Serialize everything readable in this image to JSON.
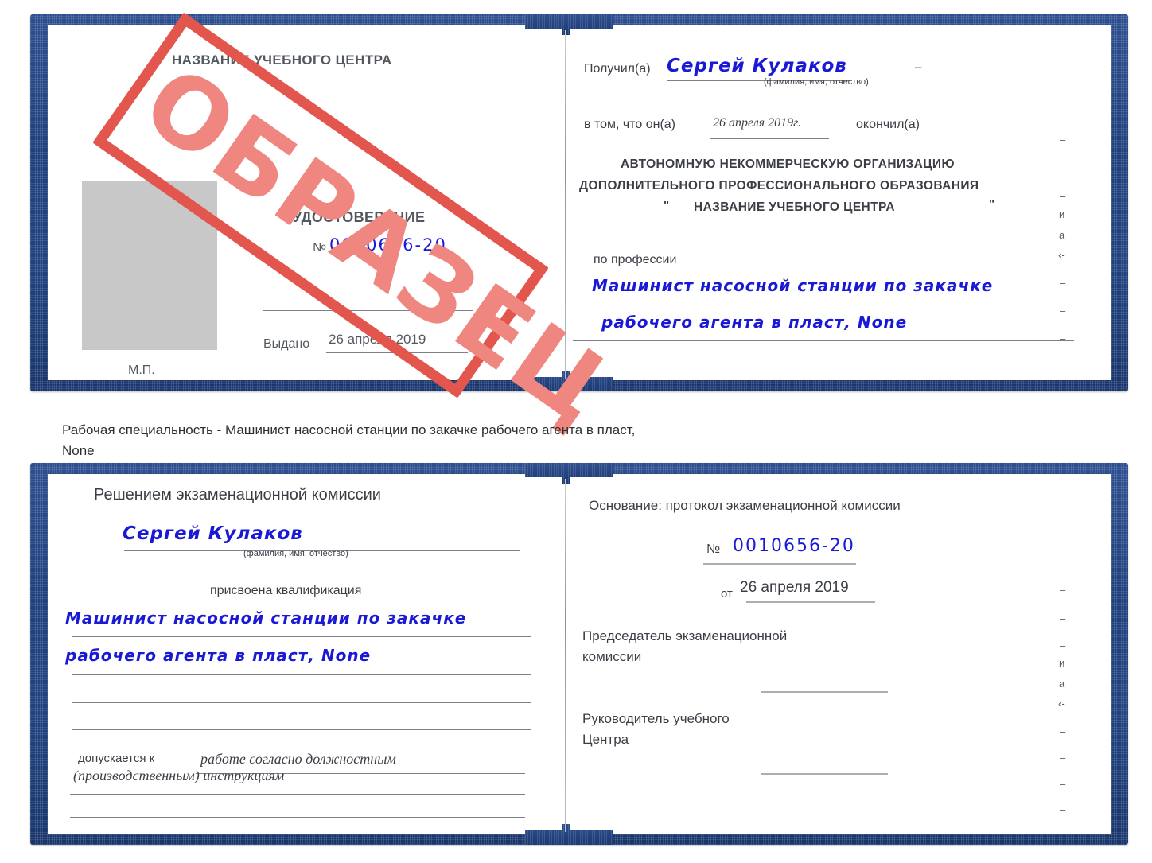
{
  "document": {
    "type": "certificate-udostoverenie",
    "stamp_label": "ОБРАЗЕЦ",
    "colors": {
      "cover_blue": "#20427f",
      "stamp_red": "#e2564e",
      "stamp_red_text": "#ef8680",
      "handwriting_blue": "#1a1ad6",
      "rule_gray": "#a9aeb5",
      "photo_placeholder_gray": "#c8c8c8",
      "page_white": "#ffffff"
    }
  },
  "top_certificate": {
    "left_page": {
      "org_title": "НАЗВАНИЕ УЧЕБНОГО ЦЕНТРА",
      "doc_type": "УДОСТОВЕРЕНИЕ",
      "number_symbol": "№",
      "number_value": "0010656-20",
      "issued_label": "Выдано",
      "issued_date": "26 апреля 2019",
      "seal_label": "М.П.",
      "photo_placeholder": ""
    },
    "right_page": {
      "received_label": "Получил(а)",
      "received_name": "Сергей Кулаков",
      "name_hint": "(фамилия, имя, отчество)",
      "that_label": "в том, что он(а)",
      "completion_date": "26 апреля 2019г.",
      "finished_label": "окончил(а)",
      "org_line1": "АВТОНОМНУЮ НЕКОММЕРЧЕСКУЮ ОРГАНИЗАЦИЮ",
      "org_line2": "ДОПОЛНИТЕЛЬНОГО ПРОФЕССИОНАЛЬНОГО ОБРАЗОВАНИЯ",
      "org_quote_open": "\"",
      "org_line3": "НАЗВАНИЕ УЧЕБНОГО ЦЕНТРА",
      "org_quote_close": "\"",
      "profession_label": "по профессии",
      "profession_line1": "Машинист насосной станции по закачке",
      "profession_line2": "рабочего агента в пласт, None",
      "edge_fragments": [
        "–",
        "–",
        "–",
        "и",
        "а",
        "‹-",
        "–",
        "–",
        "–"
      ]
    }
  },
  "caption": {
    "text": "Рабочая специальность - Машинист насосной станции по закачке рабочего агента в пласт,\nNone"
  },
  "bottom_certificate": {
    "left_page": {
      "heading": "Решением экзаменационной комиссии",
      "name": "Сергей Кулаков",
      "name_hint": "(фамилия, имя, отчество)",
      "qualification_label": "присвоена квалификация",
      "qualification_line1": "Машинист насосной станции по закачке",
      "qualification_line2": "рабочего агента в пласт, None",
      "admitted_label": "допускается к",
      "admitted_value_line1": "работе согласно должностным",
      "admitted_value_line2": "(производственным) инструкциям"
    },
    "right_page": {
      "basis_label": "Основание: протокол экзаменационной комиссии",
      "number_symbol": "№",
      "number_value": "0010656-20",
      "from_label": "от",
      "from_date": "26 апреля 2019",
      "chairman_line1": "Председатель экзаменационной",
      "chairman_line2": "комиссии",
      "head_line1": "Руководитель учебного",
      "head_line2": "Центра",
      "edge_fragments": [
        "–",
        "–",
        "–",
        "и",
        "а",
        "‹-",
        "–",
        "–",
        "–"
      ]
    }
  }
}
